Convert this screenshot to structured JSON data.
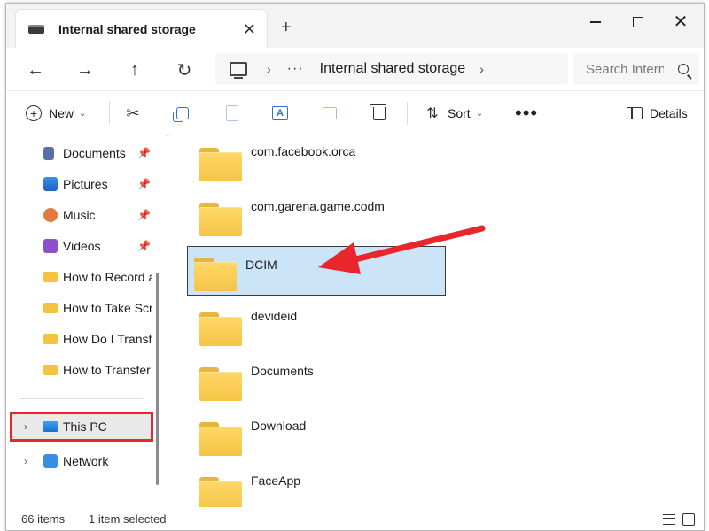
{
  "tab": {
    "title": "Internal shared storage",
    "close_glyph": "✕",
    "new_tab_glyph": "+"
  },
  "window_controls": {
    "close_glyph": "✕"
  },
  "nav": {
    "back": "←",
    "forward": "→",
    "up": "↑",
    "refresh": "↻"
  },
  "address": {
    "separator": "›",
    "more": "···",
    "current": "Internal shared storage"
  },
  "search": {
    "placeholder": "Search Internal shared storage"
  },
  "toolbar": {
    "new_label": "New",
    "sort_label": "Sort",
    "details_label": "Details",
    "more_glyph": "•••",
    "chevron": "⌄",
    "cut_glyph": "✂",
    "rename_glyph": "A",
    "sort_glyph": "⇅"
  },
  "sidebar": {
    "pin_glyph": "📌",
    "expand_glyph": "›",
    "items": [
      {
        "label": "Documents",
        "icon": "documents-icon",
        "pinned": true
      },
      {
        "label": "Pictures",
        "icon": "pictures-icon",
        "pinned": true
      },
      {
        "label": "Music",
        "icon": "music-icon",
        "pinned": true
      },
      {
        "label": "Videos",
        "icon": "videos-icon",
        "pinned": true
      },
      {
        "label": "How to Record a",
        "icon": "folder-icon"
      },
      {
        "label": "How to Take Scr",
        "icon": "folder-icon"
      },
      {
        "label": "How Do I Transf",
        "icon": "folder-icon"
      },
      {
        "label": "How  to Transfer",
        "icon": "folder-icon"
      },
      {
        "label": "This PC",
        "icon": "this-pc-icon",
        "highlighted": true
      },
      {
        "label": "Network",
        "icon": "network-icon"
      }
    ]
  },
  "files": [
    {
      "name": "com.facebook.orca"
    },
    {
      "name": "com.garena.game.codm"
    },
    {
      "name": "DCIM",
      "selected": true
    },
    {
      "name": "devideid"
    },
    {
      "name": "Documents"
    },
    {
      "name": "Download"
    },
    {
      "name": "FaceApp"
    }
  ],
  "status": {
    "item_count": "66 items",
    "selection": "1 item selected"
  },
  "colors": {
    "highlight_red": "#e8262b",
    "selection_blue": "#cce4f7",
    "folder_yellow": "#f5c447",
    "accent_blue": "#2f6fd6"
  }
}
